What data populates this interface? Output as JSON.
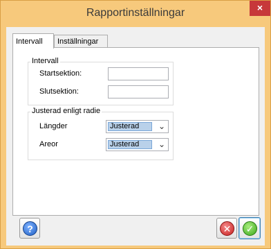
{
  "window": {
    "title": "Rapportinställningar",
    "close_glyph": "×"
  },
  "tabs": [
    {
      "label": "Intervall",
      "active": true
    },
    {
      "label": "Inställningar",
      "active": false
    }
  ],
  "interval_group": {
    "label": "Intervall",
    "start_label": "Startsektion:",
    "start_value": "",
    "end_label": "Slutsektion:",
    "end_value": ""
  },
  "adjust_group": {
    "label": "Justerad enligt radie",
    "lengths_label": "Längder",
    "lengths_value": "Justerad",
    "areas_label": "Areor",
    "areas_value": "Justerad"
  },
  "buttons": {
    "help_glyph": "?",
    "help_icon": "help-icon",
    "cancel_glyph": "✕",
    "cancel_icon": "cancel-icon",
    "ok_glyph": "✓",
    "ok_icon": "ok-checkmark-icon"
  },
  "colors": {
    "titlebar": "#f7c97c",
    "close": "#c7383a",
    "selection": "#b9d1ea"
  }
}
